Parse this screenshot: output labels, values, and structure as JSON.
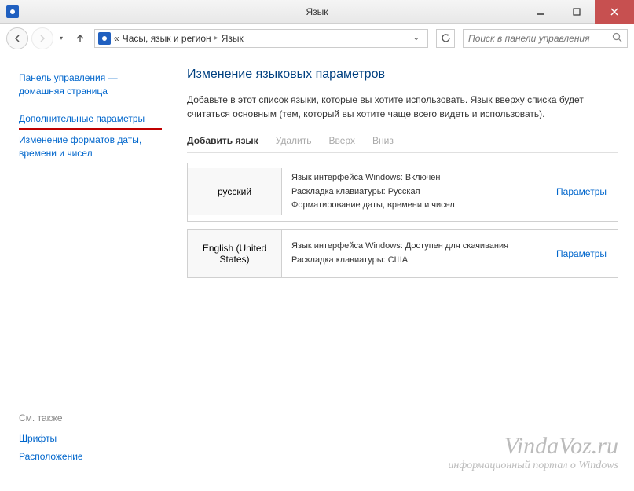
{
  "window": {
    "title": "Язык"
  },
  "breadcrumb": {
    "prefix": "«",
    "part1": "Часы, язык и регион",
    "part2": "Язык"
  },
  "search": {
    "placeholder": "Поиск в панели управления"
  },
  "sidebar": {
    "home": "Панель управления — домашняя страница",
    "advanced": "Дополнительные параметры",
    "dateformat": "Изменение форматов даты, времени и чисел",
    "seealso_title": "См. также",
    "fonts": "Шрифты",
    "location": "Расположение"
  },
  "main": {
    "title": "Изменение языковых параметров",
    "description": "Добавьте в этот список языки, которые вы хотите использовать. Язык вверху списка будет считаться основным (тем, который вы хотите чаще всего видеть и использовать)."
  },
  "toolbar": {
    "add": "Добавить язык",
    "remove": "Удалить",
    "up": "Вверх",
    "down": "Вниз"
  },
  "languages": [
    {
      "name": "русский",
      "line1": "Язык интерфейса Windows: Включен",
      "line2": "Раскладка клавиатуры: Русская",
      "line3": "Форматирование даты, времени и чисел",
      "options": "Параметры"
    },
    {
      "name": "English (United States)",
      "line1": "Язык интерфейса Windows: Доступен для скачивания",
      "line2": "Раскладка клавиатуры: США",
      "line3": "",
      "options": "Параметры"
    }
  ],
  "watermark": {
    "title": "VindaVoz.ru",
    "sub": "информационный портал о Windows"
  }
}
